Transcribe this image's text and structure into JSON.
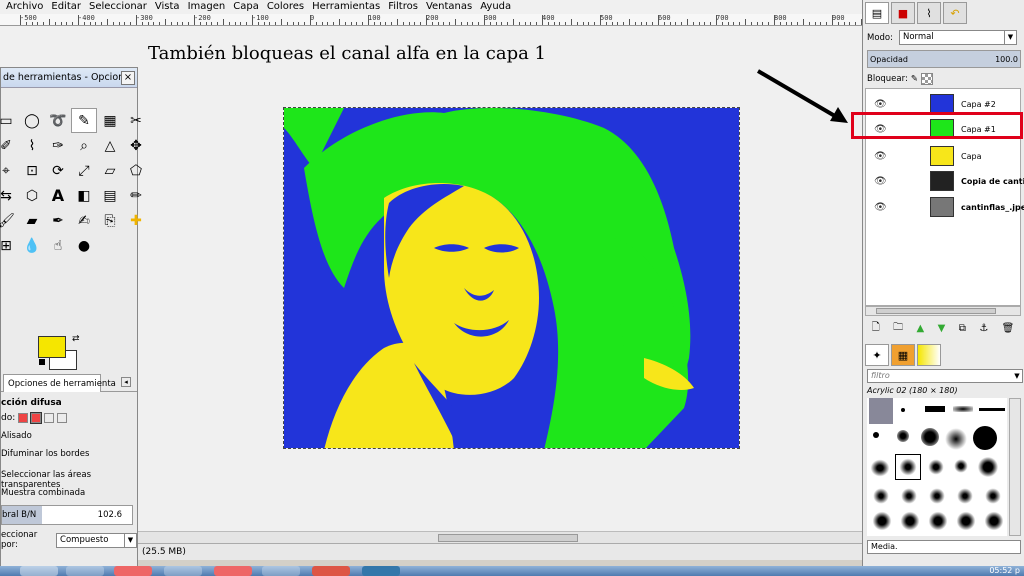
{
  "menubar": {
    "items": [
      "Archivo",
      "Editar",
      "Seleccionar",
      "Vista",
      "Imagen",
      "Capa",
      "Colores",
      "Herramientas",
      "Filtros",
      "Ventanas",
      "Ayuda"
    ]
  },
  "ruler": {
    "labels": [
      "-500",
      "-400",
      "-300",
      "-200",
      "-100",
      "0",
      "100",
      "200",
      "300",
      "400",
      "500",
      "600",
      "700",
      "800",
      "900"
    ]
  },
  "annotation": {
    "text": "También bloqueas el canal alfa en la capa 1"
  },
  "toolbox": {
    "title": "de herramientas - Opcion...",
    "close": "×",
    "tab_label": "Opciones de herramienta",
    "tool_title": "cción difusa",
    "mode_label": "do:",
    "checks": {
      "alisado": "Alisado",
      "difuminar": "Difuminar los bordes",
      "transparentes": "Seleccionar las áreas transparentes",
      "muestra": "Muestra combinada"
    },
    "threshold_label": "bral B/N",
    "threshold_value": "102.6",
    "select_by_label": "eccionar por:",
    "select_by_value": "Compuesto"
  },
  "dock": {
    "mode_label": "Modo:",
    "mode_value": "Normal",
    "opacity_label": "Opacidad",
    "opacity_value": "100.0",
    "lock_label": "Bloquear:",
    "layers": [
      {
        "name": "Capa #2"
      },
      {
        "name": "Capa #1"
      },
      {
        "name": "Capa"
      },
      {
        "name": "Copia de cantinfla"
      },
      {
        "name": "cantinflas_.jpeg"
      }
    ],
    "brush_filter_placeholder": "filtro",
    "brush_title": "Acrylic 02 (180 × 180)",
    "brush_footer": "Media."
  },
  "statusbar": {
    "text": "(25.5 MB)"
  },
  "taskbar": {
    "clock": "05:52 p"
  },
  "colors": {
    "canvas_blue": "#2234d9",
    "canvas_green": "#1ee61a",
    "canvas_yellow": "#f7e61a",
    "highlight_red": "#e0001a"
  }
}
